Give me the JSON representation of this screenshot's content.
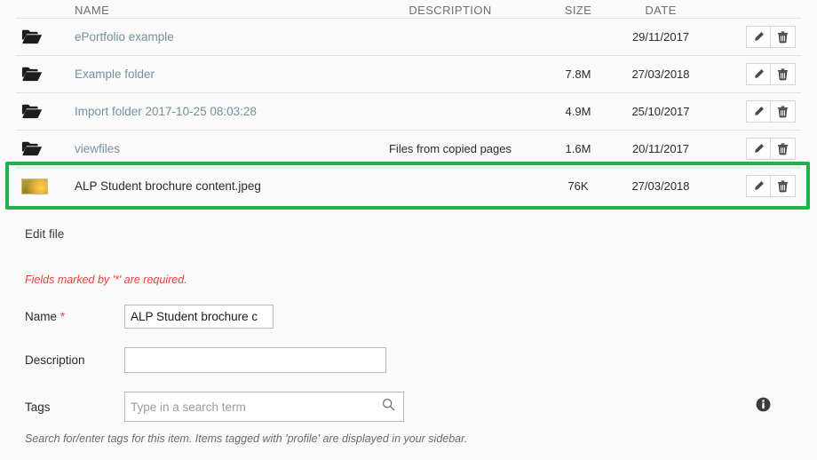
{
  "table": {
    "columns": [
      "NAME",
      "DESCRIPTION",
      "SIZE",
      "DATE"
    ],
    "rows": [
      {
        "icon": "folder-icon",
        "name": "ePortfolio example",
        "is_link": true,
        "description": "",
        "size": "",
        "date": "29/11/2017",
        "edit_label": "pencil-icon",
        "delete_label": "trash-icon"
      },
      {
        "icon": "folder-icon",
        "name": "Example folder",
        "is_link": true,
        "description": "",
        "size": "7.8M",
        "date": "27/03/2018",
        "edit_label": "pencil-icon",
        "delete_label": "trash-icon"
      },
      {
        "icon": "folder-icon",
        "name": "Import folder 2017-10-25 08:03:28",
        "is_link": true,
        "description": "",
        "size": "4.9M",
        "date": "25/10/2017",
        "edit_label": "pencil-icon",
        "delete_label": "trash-icon"
      },
      {
        "icon": "folder-icon",
        "name": "viewfiles",
        "is_link": true,
        "description": "Files from copied pages",
        "size": "1.6M",
        "date": "20/11/2017",
        "edit_label": "pencil-icon",
        "delete_label": "trash-icon"
      },
      {
        "icon": "image-thumbnail",
        "name": "ALP Student brochure content.jpeg",
        "is_link": false,
        "description": "",
        "size": "76K",
        "date": "27/03/2018",
        "edit_label": "pencil-icon",
        "delete_label": "trash-icon"
      }
    ],
    "highlighted_row_index": 4,
    "highlight_color": "#21b24b"
  },
  "form": {
    "legend": "Edit file",
    "required_note": "Fields marked by '*' are required.",
    "name": {
      "label": "Name",
      "required_marker": "*",
      "value": "ALP Student brochure c",
      "placeholder": ""
    },
    "description": {
      "label": "Description",
      "value": "",
      "placeholder": ""
    },
    "tags": {
      "label": "Tags",
      "value": "",
      "placeholder": "Type in a search term",
      "search_icon": "search-icon",
      "info_icon": "info-icon",
      "help_text": "Search for/enter tags for this item. Items tagged with 'profile' are displayed in your sidebar."
    }
  },
  "colors": {
    "link": "#76909e",
    "required": "#e8453c",
    "highlight": "#21b24b",
    "page_bg": "#fafafa"
  }
}
